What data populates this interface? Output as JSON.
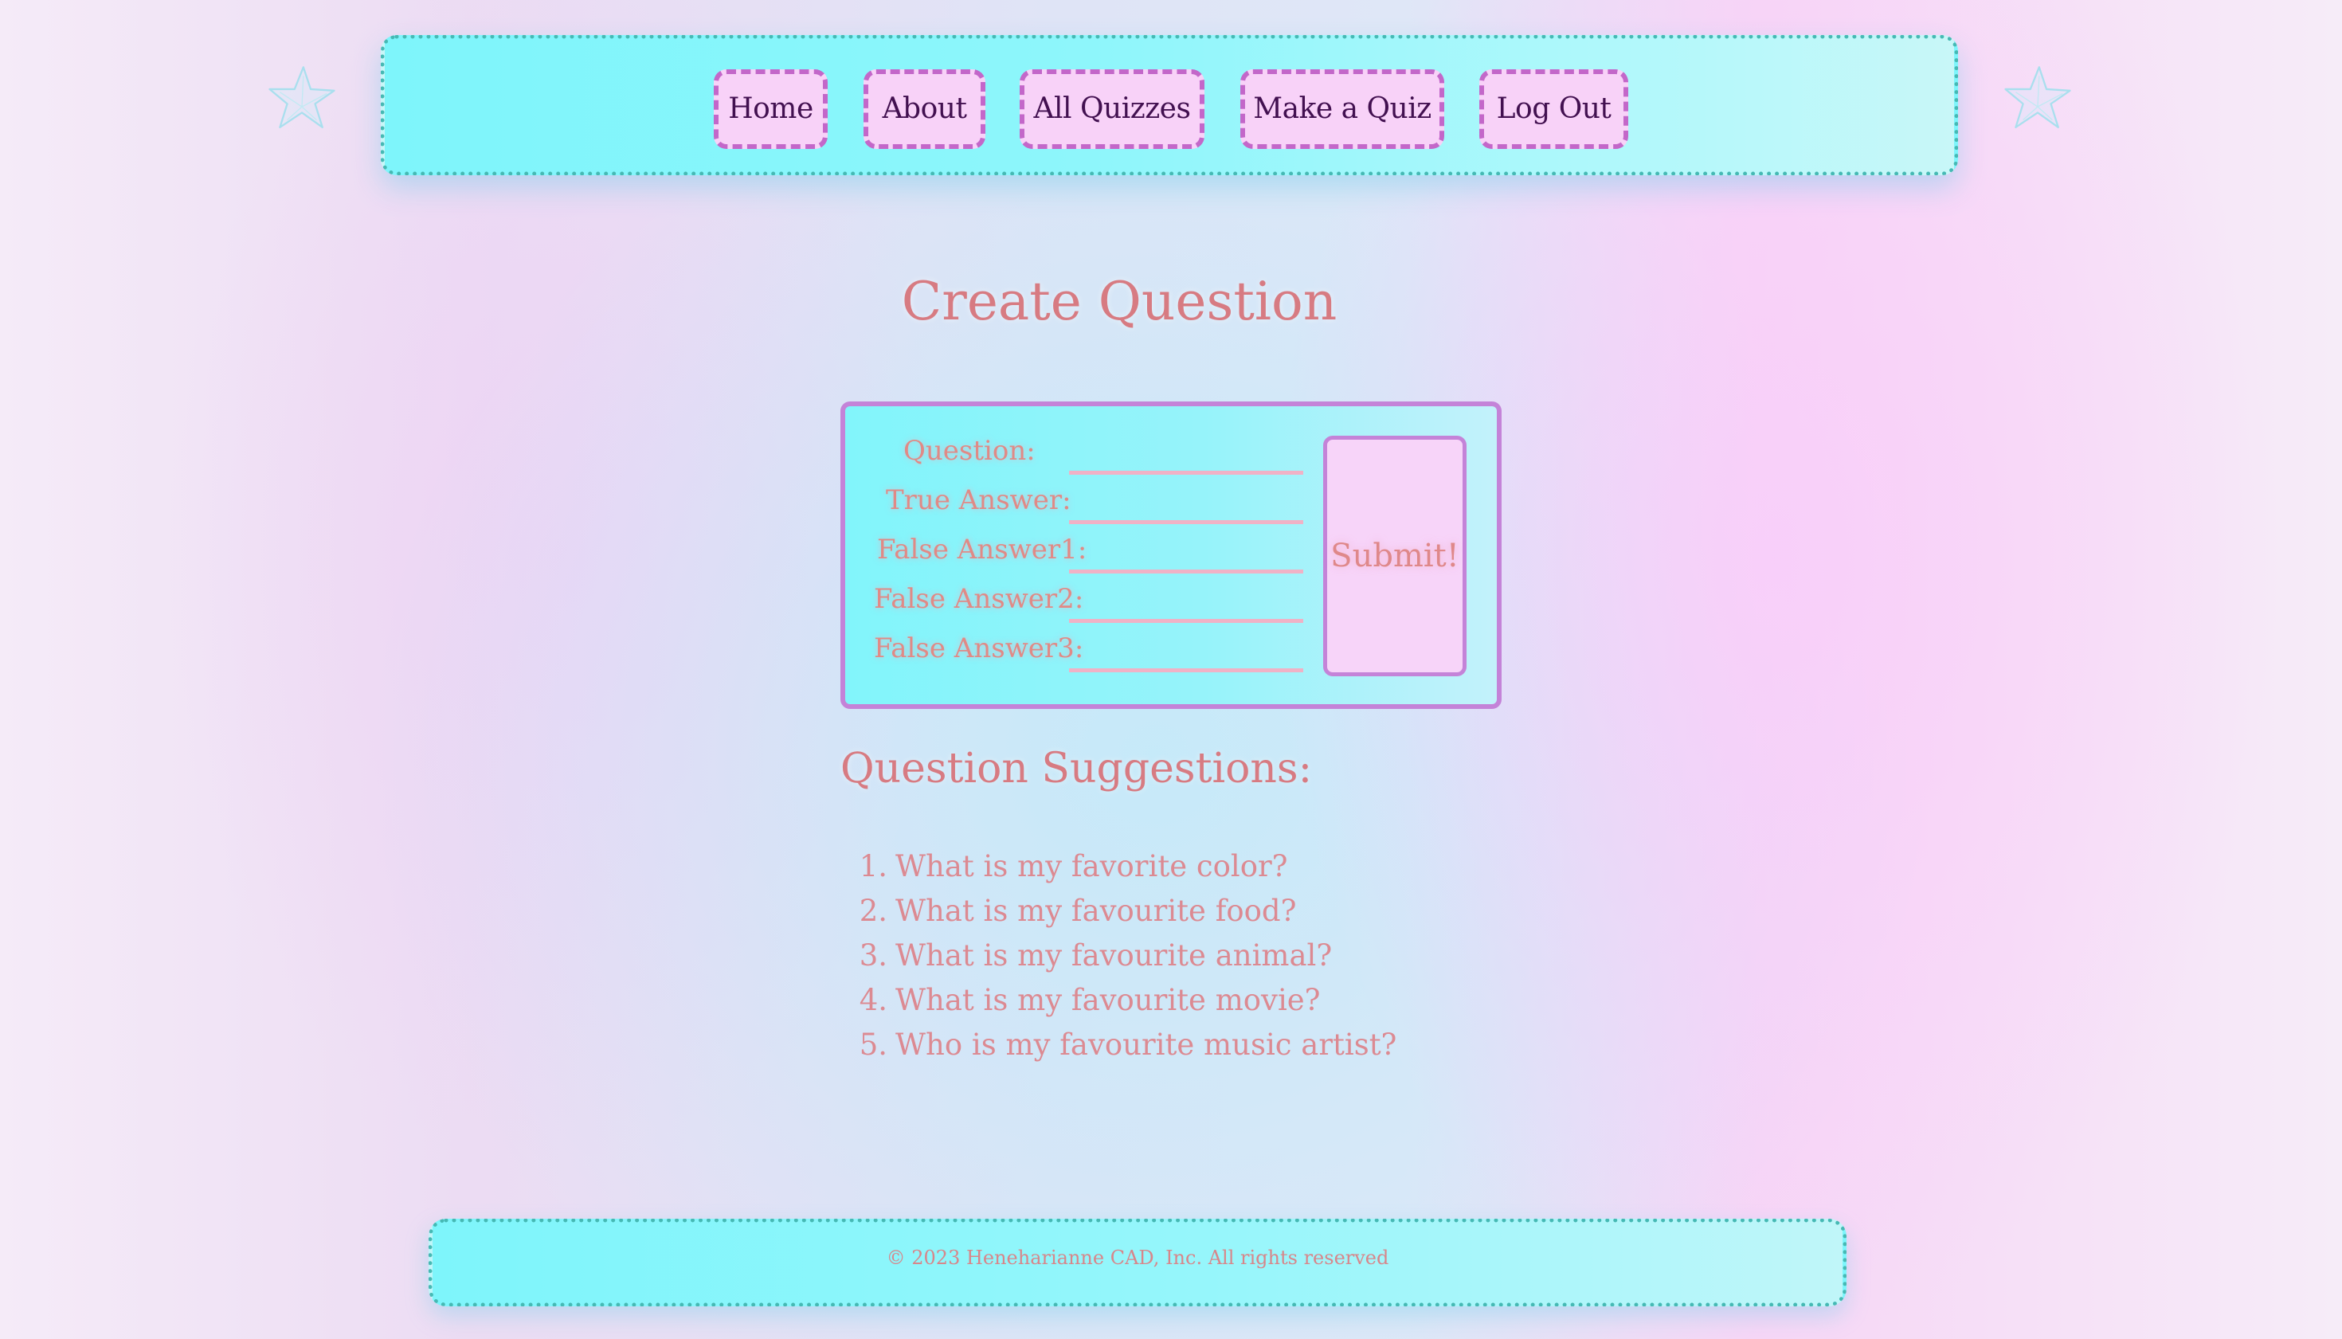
{
  "nav": {
    "items": [
      {
        "label": "Home"
      },
      {
        "label": "About"
      },
      {
        "label": "All Quizzes"
      },
      {
        "label": "Make a Quiz"
      },
      {
        "label": "Log Out"
      }
    ],
    "decorations": {
      "left": "starfish-icon",
      "right": "starfish-icon"
    }
  },
  "page": {
    "title": "Create Question"
  },
  "form": {
    "fields": [
      {
        "label": "Question:",
        "value": ""
      },
      {
        "label": "True Answer:",
        "value": ""
      },
      {
        "label": "False Answer1:",
        "value": ""
      },
      {
        "label": "False Answer2:",
        "value": ""
      },
      {
        "label": "False Answer3:",
        "value": ""
      }
    ],
    "submit_label": "Submit!"
  },
  "suggestions": {
    "heading": "Question Suggestions:",
    "items": [
      {
        "num": "1.",
        "text": "What is my favorite color?"
      },
      {
        "num": "2.",
        "text": "What is my favourite food?"
      },
      {
        "num": "3.",
        "text": "What is my favourite animal?"
      },
      {
        "num": "4.",
        "text": "What is my favourite movie?"
      },
      {
        "num": "5.",
        "text": "Who is my favourite music artist?"
      }
    ]
  },
  "footer": {
    "text": "© 2023 Heneharianne CAD, Inc. All rights reserved"
  },
  "colors": {
    "cyan_panel": "#8ef6fb",
    "dotted_border": "#46b9b4",
    "pink_button": "#f8d2f8",
    "pink_dashed_border": "#c367c9",
    "nav_text": "#421050",
    "salmon_text": "#d77b82",
    "form_border": "#c483d8"
  }
}
